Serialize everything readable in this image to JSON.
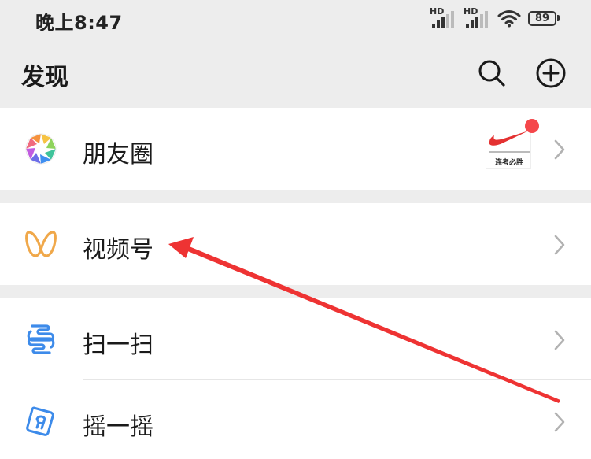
{
  "status_bar": {
    "time": "晚上8:47",
    "signal1_label": "HD",
    "signal2_label": "HD",
    "battery": "89"
  },
  "header": {
    "title": "发现",
    "search_icon": "search-icon",
    "add_icon": "add-circle-icon"
  },
  "menu": {
    "moments": {
      "label": "朋友圈",
      "icon": "moments-shutter-icon",
      "thumb_caption": "连考必胜",
      "has_new_dot": true
    },
    "channels": {
      "label": "视频号",
      "icon": "channels-butterfly-icon"
    },
    "scan": {
      "label": "扫一扫",
      "icon": "scan-icon"
    },
    "shake": {
      "label": "摇一摇",
      "icon": "shake-icon"
    }
  },
  "colors": {
    "background": "#ededed",
    "row": "#ffffff",
    "channels": "#f0a84a",
    "scan_shake_blue": "#3d8bea",
    "badge_red": "#f5474b",
    "annotation_arrow": "#ee3333"
  }
}
